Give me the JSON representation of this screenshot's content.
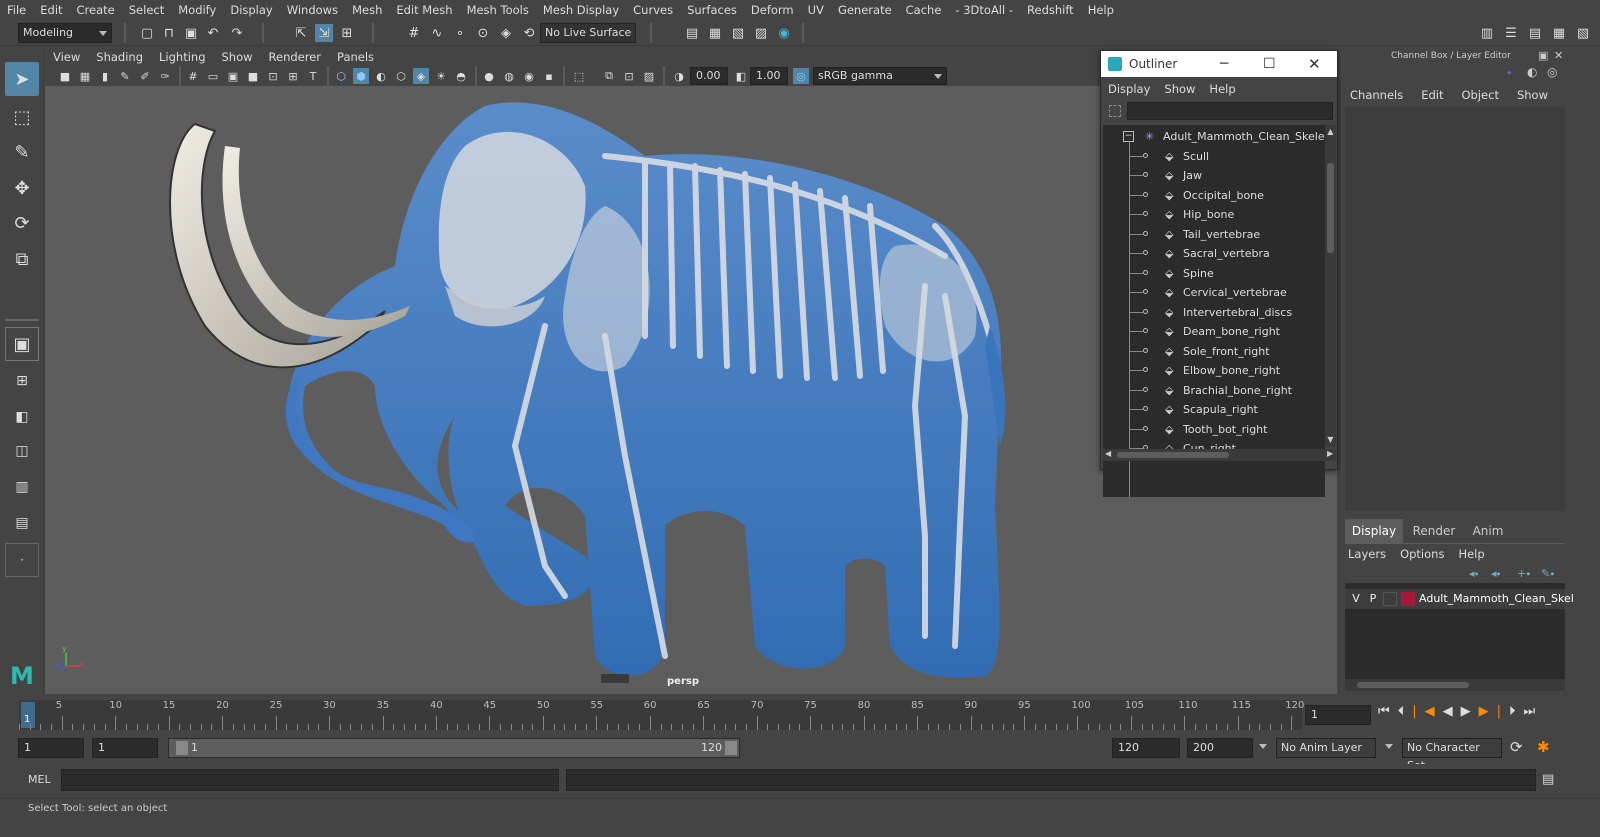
{
  "menubar": {
    "items": [
      "File",
      "Edit",
      "Create",
      "Select",
      "Modify",
      "Display",
      "Windows",
      "Mesh",
      "Edit Mesh",
      "Mesh Tools",
      "Mesh Display",
      "Curves",
      "Surfaces",
      "Deform",
      "UV",
      "Generate",
      "Cache",
      "- 3DtoAll -",
      "Redshift",
      "Help"
    ]
  },
  "statusline": {
    "menuset": "Modeling",
    "live_surface": "No Live Surface"
  },
  "viewport": {
    "menu": [
      "View",
      "Shading",
      "Lighting",
      "Show",
      "Renderer",
      "Panels"
    ],
    "exposure": "0.00",
    "gamma": "1.00",
    "colorspace": "sRGB gamma",
    "camera_label": "persp",
    "axis": {
      "x": "x",
      "y": "y",
      "z": "z"
    }
  },
  "outliner": {
    "title": "Outliner",
    "menu": [
      "Display",
      "Show",
      "Help"
    ],
    "root": "Adult_Mammoth_Clean_Skeleto",
    "items": [
      "Scull",
      "Jaw",
      "Occipital_bone",
      "Hip_bone",
      "Tail_vertebrae",
      "Sacral_vertebra",
      "Spine",
      "Cervical_vertebrae",
      "Intervertebral_discs",
      "Deam_bone_right",
      "Sole_front_right",
      "Elbow_bone_right",
      "Brachial_bone_right",
      "Scapula_right",
      "Tooth_bot_right",
      "Cun_right"
    ]
  },
  "channelbox": {
    "title": "Channel Box / Layer Editor",
    "menu": [
      "Channels",
      "Edit",
      "Object",
      "Show"
    ]
  },
  "layer_editor": {
    "tabs": [
      "Display",
      "Render",
      "Anim"
    ],
    "active_tab": "Display",
    "menu": [
      "Layers",
      "Options",
      "Help"
    ],
    "layer": {
      "v": "V",
      "p": "P",
      "name": "Adult_Mammoth_Clean_Skel",
      "color": "#a8163a"
    }
  },
  "timeline": {
    "ticks": [
      "5",
      "10",
      "15",
      "20",
      "25",
      "30",
      "35",
      "40",
      "45",
      "50",
      "55",
      "60",
      "65",
      "70",
      "75",
      "80",
      "85",
      "90",
      "95",
      "100",
      "105",
      "110",
      "115",
      "120"
    ],
    "current_label": "1",
    "current_frame": "1"
  },
  "range": {
    "start": "1",
    "playback_start": "1",
    "slider_start": "1",
    "slider_end": "120",
    "playback_end": "120",
    "end": "200",
    "anim_layer": "No Anim Layer",
    "character_set": "No Character Set"
  },
  "cmdline": {
    "label": "MEL"
  },
  "helpline": {
    "text": "Select Tool: select an object"
  }
}
